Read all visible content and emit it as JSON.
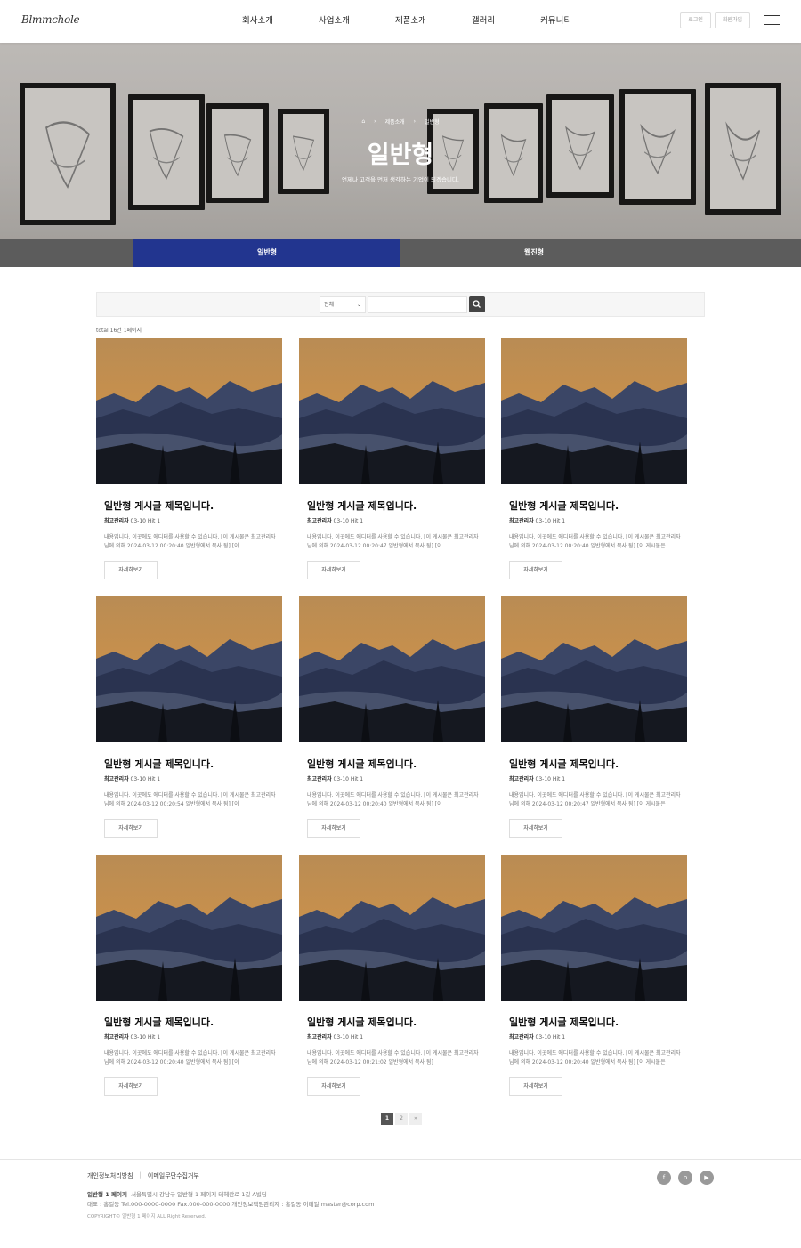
{
  "header": {
    "logo": "Blmmchole",
    "nav": [
      "회사소개",
      "사업소개",
      "제품소개",
      "갤러리",
      "커뮤니티"
    ],
    "login_label": "로그인",
    "join_label": "회원가입",
    "menu_icon": "hamburger-icon"
  },
  "hero": {
    "breadcrumb": [
      "제품소개",
      "일반형"
    ],
    "home_icon": "home-icon",
    "title": "일반형",
    "subtitle": "언제나 고객을 먼저 생각하는 기업이 되겠습니다."
  },
  "tabs": [
    {
      "label": "일반형",
      "active": true
    },
    {
      "label": "웹진형",
      "active": false
    }
  ],
  "search": {
    "select_value": "전체",
    "input_value": "",
    "button_icon": "search-icon"
  },
  "total_text": "total 16건 1페이지",
  "posts": [
    {
      "title": "일반형 게시글 제목입니다.",
      "author": "최고관리자",
      "meta": "03-10 Hit 1",
      "body": "내용입니다. 이곳에도 에디터를 사용할 수 있습니다. [이 게시물은 최고관리자님에 의해 2024-03-12 00:20:40 일반형에서 복사 됨] [이",
      "button": "자세히보기"
    },
    {
      "title": "일반형 게시글 제목입니다.",
      "author": "최고관리자",
      "meta": "03-10 Hit 1",
      "body": "내용입니다. 이곳에도 에디터를 사용할 수 있습니다. [이 게시물은 최고관리자님에 의해 2024-03-12 00:20:47 일반형에서 복사 됨] [이",
      "button": "자세히보기"
    },
    {
      "title": "일반형 게시글 제목입니다.",
      "author": "최고관리자",
      "meta": "03-10 Hit 1",
      "body": "내용입니다. 이곳에도 에디터를 사용할 수 있습니다. [이 게시물은 최고관리자님에 의해 2024-03-12 00:20:40 일반형에서 복사 됨] [이 게시물은",
      "button": "자세히보기"
    },
    {
      "title": "일반형 게시글 제목입니다.",
      "author": "최고관리자",
      "meta": "03-10 Hit 1",
      "body": "내용입니다. 이곳에도 에디터를 사용할 수 있습니다. [이 게시물은 최고관리자님에 의해 2024-03-12 00:20:54 일반형에서 복사 됨] [이",
      "button": "자세히보기"
    },
    {
      "title": "일반형 게시글 제목입니다.",
      "author": "최고관리자",
      "meta": "03-10 Hit 1",
      "body": "내용입니다. 이곳에도 에디터를 사용할 수 있습니다. [이 게시물은 최고관리자님에 의해 2024-03-12 00:20:40 일반형에서 복사 됨] [이",
      "button": "자세히보기"
    },
    {
      "title": "일반형 게시글 제목입니다.",
      "author": "최고관리자",
      "meta": "03-10 Hit 1",
      "body": "내용입니다. 이곳에도 에디터를 사용할 수 있습니다. [이 게시물은 최고관리자님에 의해 2024-03-12 00:20:47 일반형에서 복사 됨] [이 게시물은",
      "button": "자세히보기"
    },
    {
      "title": "일반형 게시글 제목입니다.",
      "author": "최고관리자",
      "meta": "03-10 Hit 1",
      "body": "내용입니다. 이곳에도 에디터를 사용할 수 있습니다. [이 게시물은 최고관리자님에 의해 2024-03-12 00:20:40 일반형에서 복사 됨] [이",
      "button": "자세히보기"
    },
    {
      "title": "일반형 게시글 제목입니다.",
      "author": "최고관리자",
      "meta": "03-10 Hit 1",
      "body": "내용입니다. 이곳에도 에디터를 사용할 수 있습니다. [이 게시물은 최고관리자님에 의해 2024-03-12 00:21:02 일반형에서 복사 됨]",
      "button": "자세히보기"
    },
    {
      "title": "일반형 게시글 제목입니다.",
      "author": "최고관리자",
      "meta": "03-10 Hit 1",
      "body": "내용입니다. 이곳에도 에디터를 사용할 수 있습니다. [이 게시물은 최고관리자님에 의해 2024-03-12 00:20:40 일반형에서 복사 됨] [이 게시물은",
      "button": "자세히보기"
    }
  ],
  "pagination": {
    "pages": [
      "1",
      "2"
    ],
    "next": "»",
    "current": "1"
  },
  "footer": {
    "links": [
      "개인정보처리방침",
      "이메일무단수집거부"
    ],
    "company": "일반형 1 페이지",
    "address": "서울특별시 강남구 일반형 1 페이지 테헤란로 1길 A빌딩",
    "contact": "대표 : 홍길동    Tel.000-0000-0000    Fax.000-000-0000    개인정보책임관리자 : 홍길동 이메일:master@corp.com",
    "copyright": "COPYRIGHT© 일반형 1 페이지 ALL Right Reserved.",
    "social": [
      "facebook-icon",
      "blog-icon",
      "youtube-icon"
    ]
  },
  "colors": {
    "accent": "#22358f",
    "tab_bar": "#5c5c5c"
  }
}
